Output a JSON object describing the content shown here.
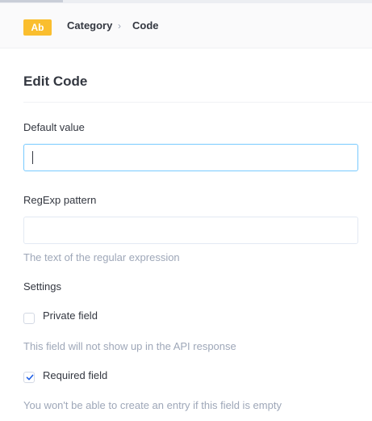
{
  "header": {
    "badge": "Ab",
    "breadcrumb": [
      "Category",
      "Code"
    ],
    "separator": "›"
  },
  "form": {
    "title": "Edit Code",
    "default_value": {
      "label": "Default value",
      "value": "",
      "placeholder": ""
    },
    "regexp": {
      "label": "RegExp pattern",
      "value": "",
      "placeholder": "",
      "help": "The text of the regular expression"
    },
    "settings": {
      "label": "Settings",
      "private": {
        "label": "Private field",
        "checked": false,
        "help": "This field will not show up in the API response"
      },
      "required": {
        "label": "Required field",
        "checked": true,
        "help": "You won't be able to create an entry if this field is empty"
      }
    }
  },
  "colors": {
    "accent": "#fabe2e",
    "focus": "#78caff",
    "check": "#1c5de7"
  }
}
